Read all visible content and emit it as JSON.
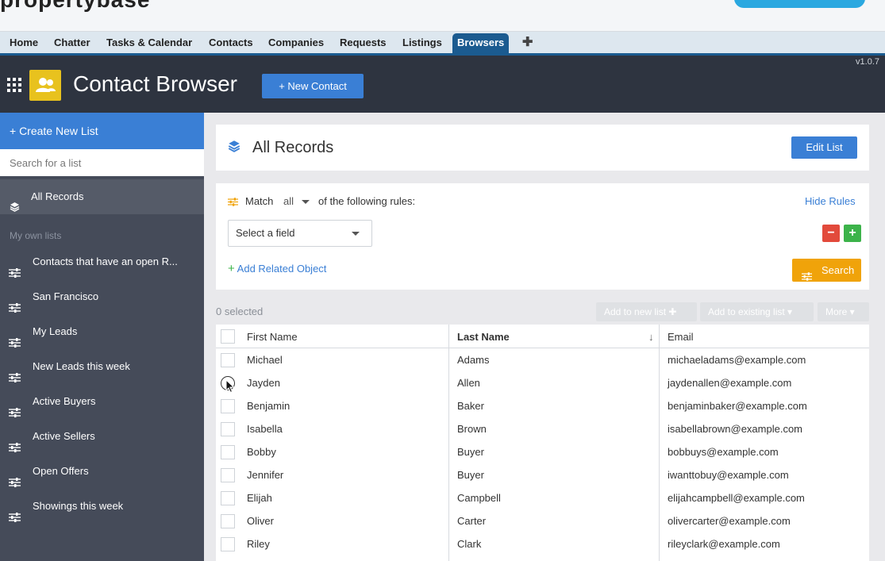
{
  "nav": {
    "tabs": [
      "Home",
      "Chatter",
      "Tasks & Calendar",
      "Contacts",
      "Companies",
      "Requests",
      "Listings",
      "Browsers"
    ],
    "active_tab": "Browsers",
    "add_tab_icon": "plus-icon"
  },
  "header": {
    "title": "Contact Browser",
    "new_button": "+ New Contact",
    "version": "v1.0.7"
  },
  "sidebar": {
    "create_list": "+ Create New List",
    "search_placeholder": "Search for a list",
    "all_records": "All Records",
    "section_label": "My own lists",
    "lists": [
      "Contacts that have an open R...",
      "San Francisco",
      "My Leads",
      "New Leads this week",
      "Active Buyers",
      "Active Sellers",
      "Open Offers",
      "Showings this week"
    ]
  },
  "records_panel": {
    "title": "All Records",
    "edit_button": "Edit List"
  },
  "rules": {
    "match_label": "Match",
    "match_value": "all",
    "following_text": "of the following rules:",
    "hide_rules": "Hide Rules",
    "field_select": "Select a field",
    "add_related": "Add Related Object",
    "search_button": "Search"
  },
  "selection": {
    "selected_text": "0 selected",
    "add_to_new": "Add to new list",
    "add_to_existing": "Add to existing list",
    "more": "More"
  },
  "table": {
    "columns": [
      "First Name",
      "Last Name",
      "Email"
    ],
    "sort_indicator": "↓",
    "rows": [
      [
        "Michael",
        "Adams",
        "michaeladams@example.com"
      ],
      [
        "Jayden",
        "Allen",
        "jaydenallen@example.com"
      ],
      [
        "Benjamin",
        "Baker",
        "benjaminbaker@example.com"
      ],
      [
        "Isabella",
        "Brown",
        "isabellabrown@example.com"
      ],
      [
        "Bobby",
        "Buyer",
        "bobbuys@example.com"
      ],
      [
        "Jennifer",
        "Buyer",
        "iwanttobuy@example.com"
      ],
      [
        "Elijah",
        "Campbell",
        "elijahcampbell@example.com"
      ],
      [
        "Oliver",
        "Carter",
        "olivercarter@example.com"
      ],
      [
        "Riley",
        "Clark",
        "rileyclark@example.com"
      ]
    ]
  },
  "colors": {
    "accent": "#3a7fd5",
    "header_bg": "#2e3440",
    "sidebar_bg": "#454b59",
    "search_orange": "#f0a30a",
    "remove_red": "#e24a3b",
    "add_green": "#3cb34a"
  }
}
